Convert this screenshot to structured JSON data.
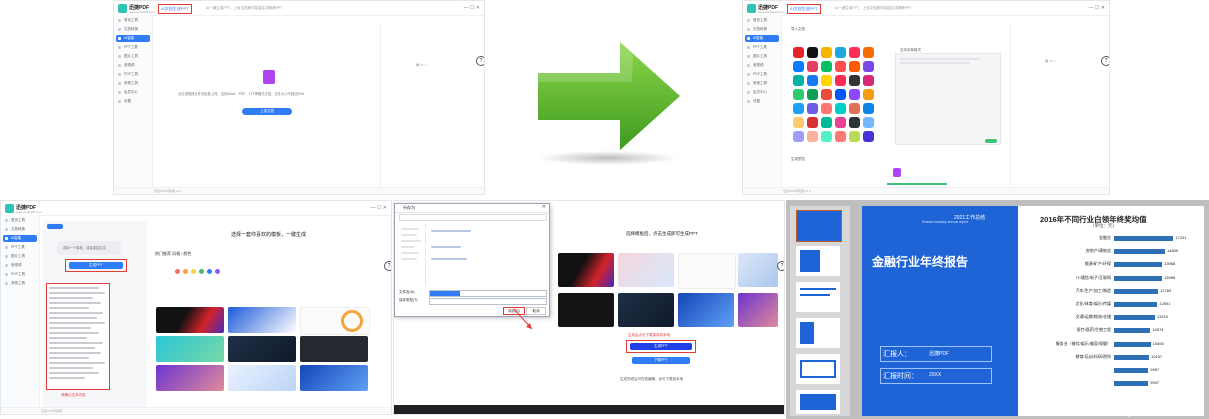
{
  "app": {
    "brand": "迅捷PDF",
    "brand_sub": "www.xunjiepdf.com"
  },
  "sidebar": {
    "items": [
      "首页工具",
      "文档转换",
      "AI智能",
      "PPT工具",
      "图片工具",
      "音视频",
      "PDF工具",
      "其他工具",
      "会员中心",
      "设置"
    ]
  },
  "tab_label": "AI文档生成PPT",
  "crumb_text": "AI一键生成PPT，上传文档即可智能生成精美PPT",
  "panel_tl": {
    "upload_hint": "点击或拖拽文件到此处上传，支持Word、PDF、TXT等格式文档，文件大小不超过50M",
    "upload_btn": "上传文档",
    "status": "迅捷PDF转换器 v6.0"
  },
  "panel_tr": {
    "section": "导入文档",
    "hint": "支持多种格式",
    "preview": "生成预览",
    "status": "迅捷PDF转换器 v6.0"
  },
  "panel_bl": {
    "left_btn": "生成PPT",
    "desc": "选择一个模板，或者直接生成",
    "right_title": "选择一套你喜欢的模板，一键生成",
    "right_sub": "热门推荐 风格 / 颜色",
    "note": "请确认文本内容",
    "status": "迅捷PDF转换器"
  },
  "panel_bm": {
    "dialog_title": "另存为",
    "save_btn": "保存(S)",
    "cancel_btn": "取消",
    "file_name_label": "文件名(N):",
    "file_type_label": "保存类型(T):",
    "title": "选择模板后，点击生成即可生成PPT",
    "generate_btn": "生成PPT",
    "download_btn": "下载PPT",
    "note": "生成完成后可在线编辑，也可下载到本地",
    "annot": "生成后点击下载保存到本地"
  },
  "ppt": {
    "cover_title": "金融行业年终报告",
    "cover_top": "2021工作总结",
    "cover_sub": "finance industry annual report",
    "reporter_label": "汇报人：",
    "reporter_val": "迅捷PDF",
    "date_label": "汇报时间：",
    "date_val": "20XX"
  },
  "watermark": "CSDN @giser@2011",
  "colors": {
    "arrow": "#5cb531",
    "accent": "#2f7cf6",
    "annotation": "#e23b3b",
    "ppt_blue": "#1e64d6"
  },
  "chart_data": {
    "type": "bar",
    "title": "2016年不同行业白领年终奖均值",
    "subtitle": "（单位：元）",
    "categories": [
      "金融业",
      "房地产/建筑业",
      "能源/矿产/环保",
      "IT/通信/电子/互联网",
      "汽车/生产/加工/制造",
      "文化/体育/娱乐/传媒",
      "交通/运输/物流/仓储",
      "医疗/医药/生物工程",
      "服务业（餐饮/娱乐/美容/保健）",
      "教育/培训/科研/院所"
    ],
    "values": [
      17241,
      14809,
      13968,
      13958,
      12783,
      12591,
      11919,
      10574,
      10650,
      10157
    ],
    "extra_values": [
      9957,
      9937
    ],
    "orientation": "horizontal",
    "xlim": [
      0,
      18000
    ]
  }
}
